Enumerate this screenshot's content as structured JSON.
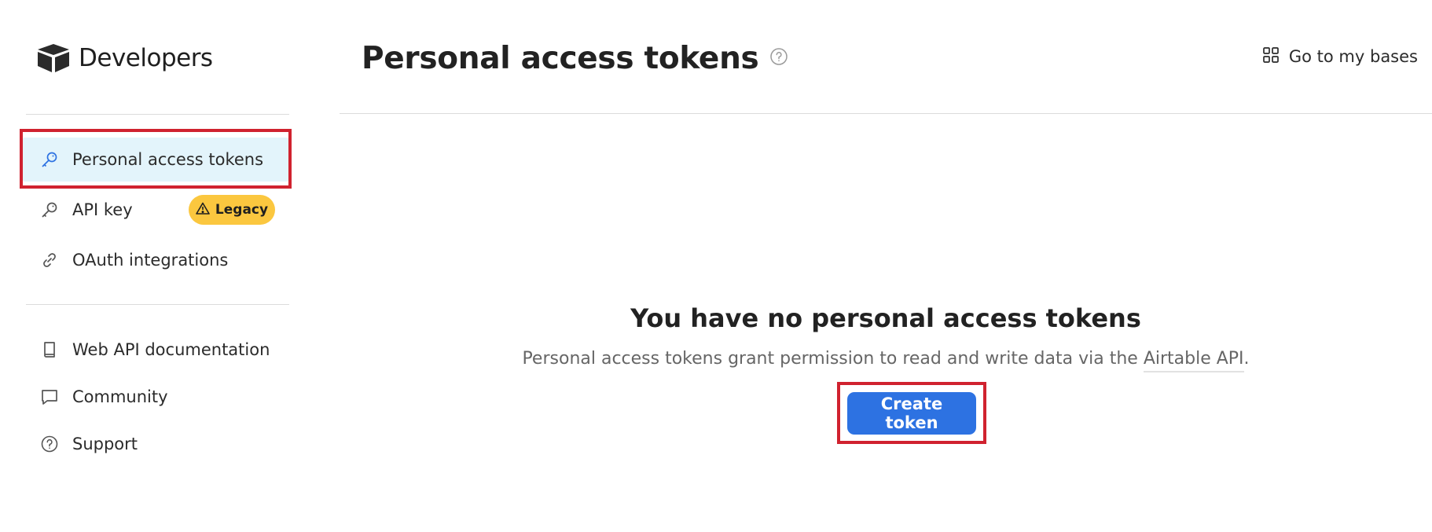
{
  "brand": {
    "name": "Developers",
    "logo_icon": "box-logo-icon"
  },
  "sidebar": {
    "primary_items": [
      {
        "label": "Personal access tokens",
        "icon": "key-icon",
        "active": true
      },
      {
        "label": "API key",
        "icon": "key-icon",
        "badge": "Legacy",
        "badge_icon": "warning-icon"
      },
      {
        "label": "OAuth integrations",
        "icon": "link-icon"
      }
    ],
    "secondary_items": [
      {
        "label": "Web API documentation",
        "icon": "book-icon"
      },
      {
        "label": "Community",
        "icon": "chat-bubble-icon"
      },
      {
        "label": "Support",
        "icon": "help-circle-icon"
      }
    ]
  },
  "header": {
    "title": "Personal access tokens",
    "help_icon": "help-circle-icon",
    "go_to_bases_label": "Go to my bases",
    "go_to_bases_icon": "grid-icon"
  },
  "empty_state": {
    "title": "You have no personal access tokens",
    "description_prefix": "Personal access tokens grant permission to read and write data via the ",
    "description_link": "Airtable API",
    "description_suffix": ".",
    "button_label": "Create token"
  },
  "colors": {
    "accent": "#2d72e2",
    "active_bg": "#e3f4fb",
    "badge_bg": "#fbc73f",
    "highlight": "#d0222f"
  }
}
